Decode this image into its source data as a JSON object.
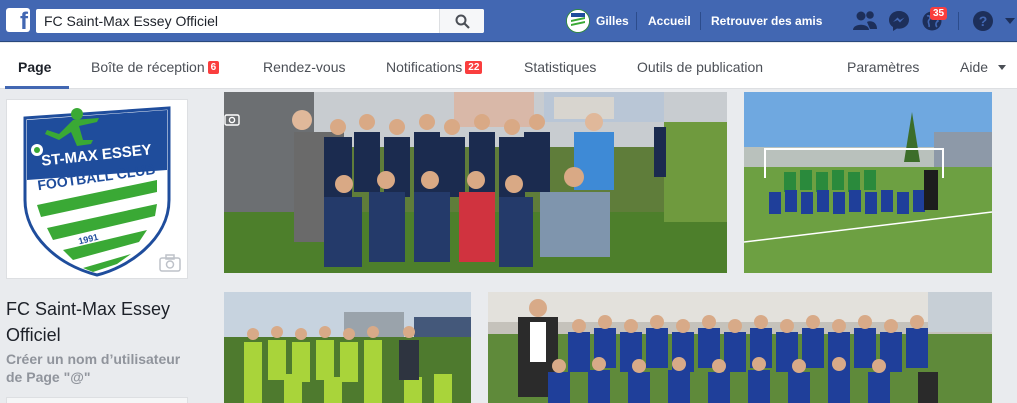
{
  "topbar": {
    "search_value": "FC Saint-Max Essey Officiel",
    "user_name": "Gilles",
    "home_label": "Accueil",
    "find_friends_label": "Retrouver des amis",
    "notifications_count": "35",
    "help_label": "?"
  },
  "tabs": {
    "page": "Page",
    "inbox": "Boîte de réception",
    "inbox_count": "6",
    "appointments": "Rendez-vous",
    "notifications": "Notifications",
    "notifications_count": "22",
    "stats": "Statistiques",
    "publishing": "Outils de publication",
    "settings": "Paramètres",
    "help": "Aide"
  },
  "page": {
    "name": "FC Saint-Max Essey Officiel",
    "create_username": "Créer un nom d’utilisateur de Page \"@\""
  },
  "logo": {
    "line1": "ST-MAX ESSEY",
    "line2": "FOOTBALL CLUB",
    "year": "1991"
  },
  "colors": {
    "brand_blue": "#4267b2",
    "club_blue": "#1f4d9c",
    "club_green": "#3aa935",
    "badge_red": "#fa3e3e"
  },
  "icons": {
    "search": "search-icon",
    "friends": "friend-requests-icon",
    "messenger": "messenger-icon",
    "globe": "notifications-globe-icon",
    "help": "help-icon",
    "camera": "camera-icon",
    "caret": "caret-down-icon"
  }
}
